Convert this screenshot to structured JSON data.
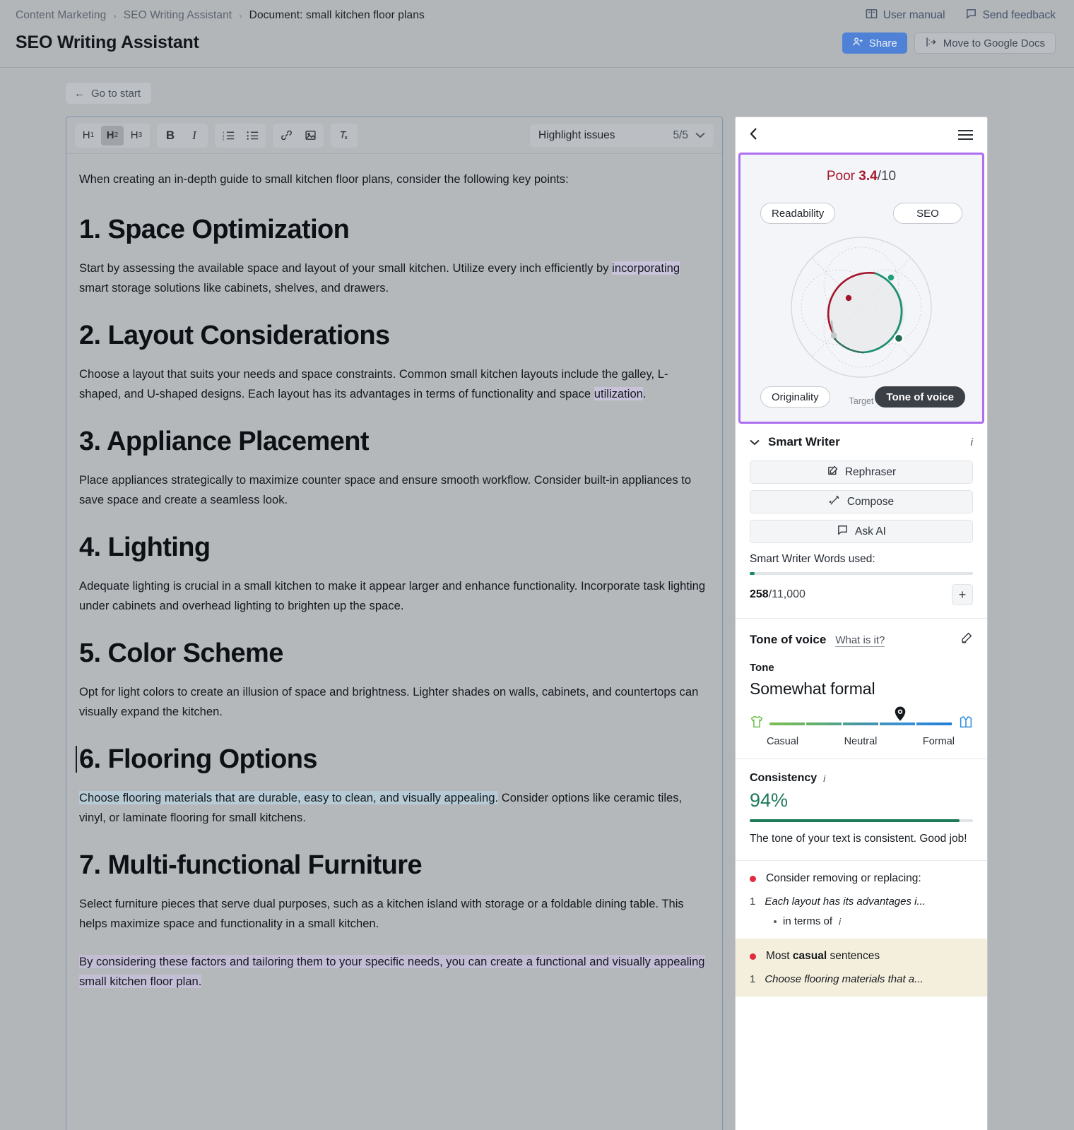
{
  "header": {
    "breadcrumb": [
      {
        "label": "Content Marketing"
      },
      {
        "label": "SEO Writing Assistant"
      },
      {
        "label": "Document: small kitchen floor plans"
      }
    ],
    "separator": "›",
    "title": "SEO Writing Assistant",
    "user_manual": "User manual",
    "send_feedback": "Send feedback",
    "share": "Share",
    "move_to_google_docs": "Move to Google Docs"
  },
  "toolbar": {
    "go_to_start": "Go to start",
    "back_arrow": "←",
    "h1": "H",
    "h1_sub": "1",
    "h2": "H",
    "h2_sub": "2",
    "h3": "H",
    "h3_sub": "3",
    "bold": "B",
    "italic": "I",
    "highlight_issues_label": "Highlight issues",
    "highlight_issues_count": "5/5",
    "chevron": "⌄"
  },
  "document": {
    "intro": "When creating an in-depth guide to small kitchen floor plans, consider the following key points:",
    "sections": [
      {
        "heading": "1. Space Optimization",
        "body_pre": "Start by assessing the available space and layout of your small kitchen. Utilize every inch efficiently by ",
        "body_hl": "incorporating",
        "body_post": " smart storage solutions like cabinets, shelves, and drawers."
      },
      {
        "heading": "2. Layout Considerations",
        "body_pre": "Choose a layout that suits your needs and space constraints. Common small kitchen layouts include the galley, L-shaped, and U-shaped designs. Each layout has its advantages in terms of functionality and space ",
        "body_hl": "utilization",
        "body_post": "."
      },
      {
        "heading": "3. Appliance Placement",
        "body_pre": "Place appliances strategically to maximize counter space and ensure smooth workflow. Consider built-in appliances to save space and create a seamless look.",
        "body_hl": "",
        "body_post": ""
      },
      {
        "heading": "4. Lighting",
        "body_pre": "Adequate lighting is crucial in a small kitchen to make it appear larger and enhance functionality. Incorporate task lighting under cabinets and overhead lighting to brighten up the space.",
        "body_hl": "",
        "body_post": ""
      },
      {
        "heading": "5. Color Scheme",
        "body_pre": "Opt for light colors to create an illusion of space and brightness. Lighter shades on walls, cabinets, and countertops can visually expand the kitchen.",
        "body_hl": "",
        "body_post": ""
      },
      {
        "heading": "6. Flooring Options",
        "body_pre": "",
        "body_hl": "Choose flooring materials that are durable, easy to clean, and visually appealing.",
        "body_post": " Consider options like ceramic tiles, vinyl, or laminate flooring for small kitchens."
      },
      {
        "heading": "7. Multi-functional Furniture",
        "body_pre": "Select furniture pieces that serve dual purposes, such as a kitchen island with storage or a foldable dining table. This helps maximize space and functionality in a small kitchen.",
        "body_hl": "",
        "body_post": ""
      }
    ],
    "closing": "By considering these factors and tailoring them to your specific needs, you can create a functional and visually appealing small kitchen floor plan."
  },
  "panel": {
    "score": {
      "quality": "Poor",
      "value": "3.4",
      "denominator": "/10",
      "target_label": "Target",
      "metrics": [
        {
          "label": "Readability",
          "active": false
        },
        {
          "label": "SEO",
          "active": false
        },
        {
          "label": "Originality",
          "active": false
        },
        {
          "label": "Tone of voice",
          "active": true
        }
      ],
      "accent_border": "#ad6ef0",
      "poor_color": "#a8172e"
    },
    "smart_writer": {
      "title": "Smart Writer",
      "info": "i",
      "chevron": "⌄",
      "buttons": [
        {
          "label": "Rephraser",
          "icon": "pencil-square-icon"
        },
        {
          "label": "Compose",
          "icon": "magic-wand-icon"
        },
        {
          "label": "Ask AI",
          "icon": "chat-bubble-icon"
        }
      ],
      "words_used_label": "Smart Writer Words used:",
      "words_used": "258",
      "words_total": "/11,000",
      "plus": "+"
    },
    "tone_of_voice": {
      "title": "Tone of voice",
      "what_is_it": "What is it?",
      "tone_label": "Tone",
      "tone_value": "Somewhat formal",
      "ticks": [
        "Casual",
        "Neutral",
        "Formal"
      ],
      "marker_position_percent": 71
    },
    "consistency": {
      "title": "Consistency",
      "info": "i",
      "value": "94%",
      "percent": 94,
      "message": "The tone of your text is consistent. Good job!",
      "bar_color": "#1c7a57"
    },
    "issues": [
      {
        "title": "Consider removing or replacing:",
        "highlighted": false,
        "items": [
          {
            "num": "1",
            "quote": "Each layout has its advantages i...",
            "sub": "in terms of",
            "sub_info": "i"
          }
        ]
      },
      {
        "title_pre": "Most ",
        "title_bold": "casual",
        "title_post": " sentences",
        "highlighted": true,
        "items": [
          {
            "num": "1",
            "quote": "Choose flooring materials that a...",
            "sub": "",
            "sub_info": ""
          }
        ]
      }
    ]
  }
}
